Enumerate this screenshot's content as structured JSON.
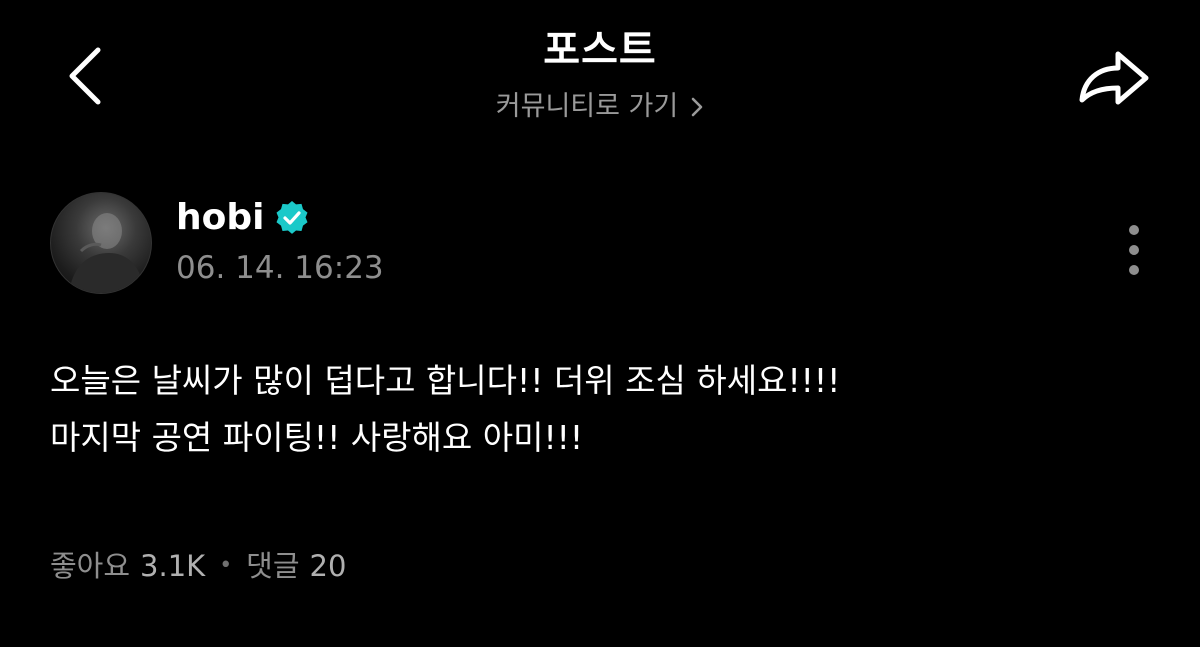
{
  "header": {
    "title": "포스트",
    "community_link": "커뮤니티로 가기",
    "back_icon": "chevron-left-icon",
    "share_icon": "share-icon"
  },
  "author": {
    "name": "hobi",
    "verified": true,
    "timestamp": "06. 14. 16:23"
  },
  "post": {
    "lines": [
      "오늘은 날씨가 많이 덥다고 합니다!! 더위 조심 하세요!!!!",
      "마지막 공연 파이팅!! 사랑해요 아미!!!"
    ]
  },
  "stats": {
    "likes_label": "좋아요",
    "likes_value": "3.1K",
    "separator": "•",
    "comments_label": "댓글",
    "comments_value": "20"
  },
  "colors": {
    "background": "#000000",
    "text": "#ffffff",
    "muted": "#8e8e8e",
    "verified": "#1bc9c9"
  }
}
